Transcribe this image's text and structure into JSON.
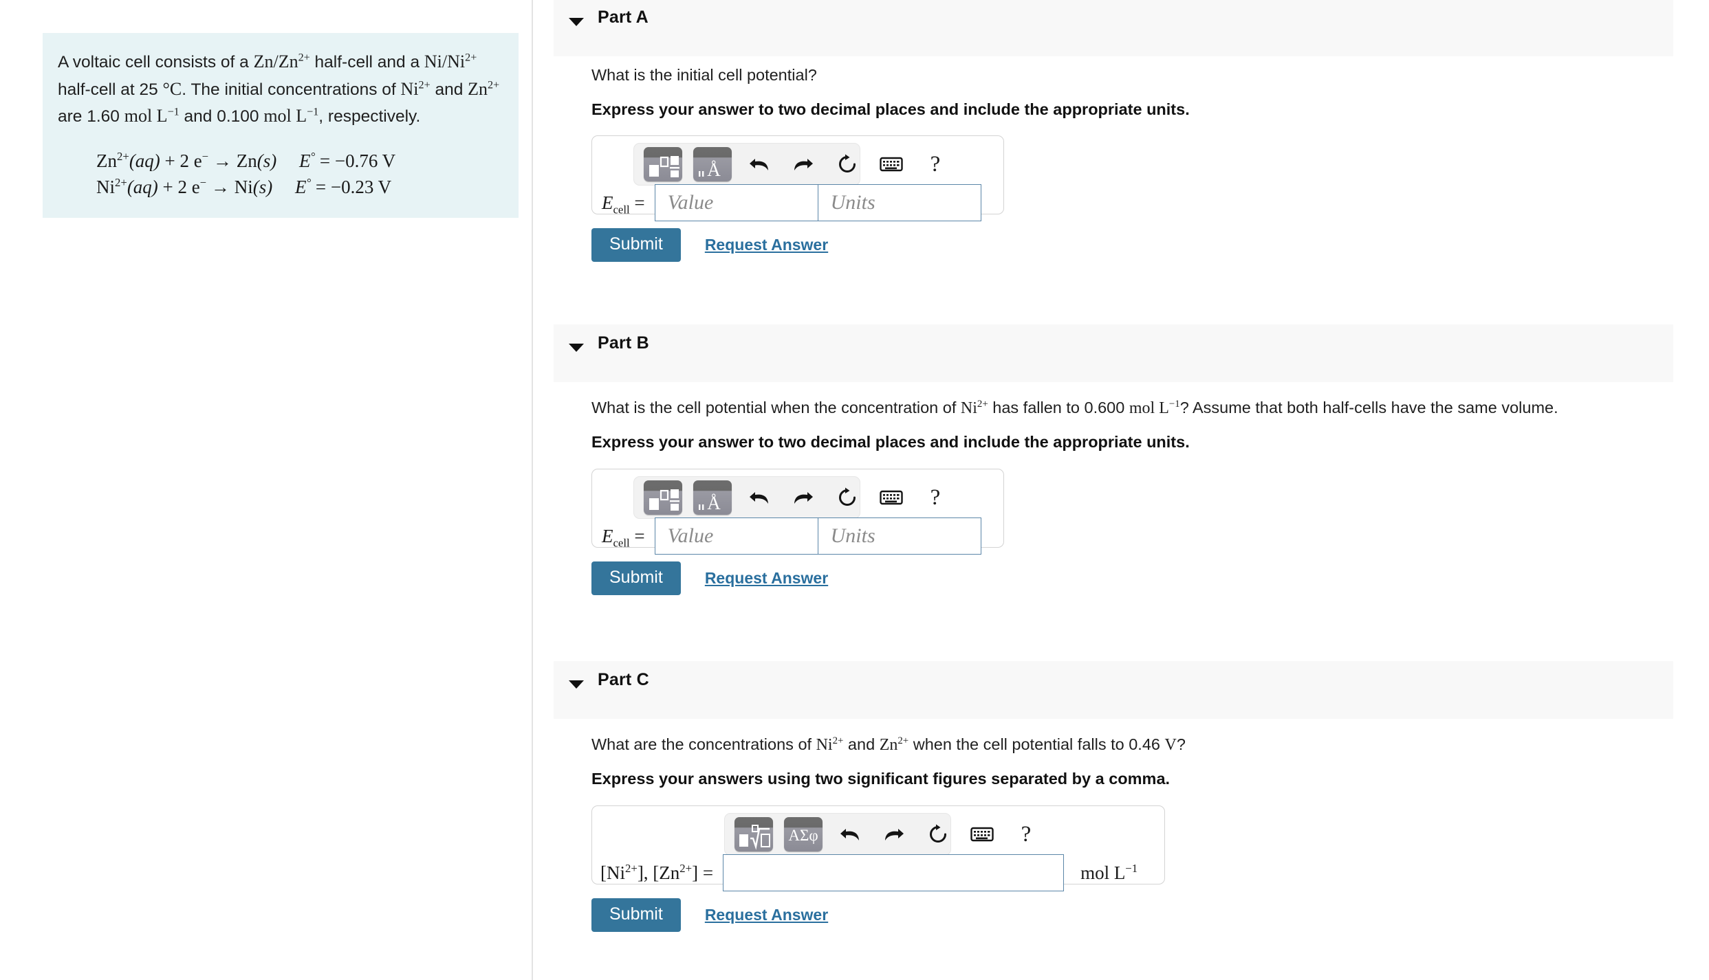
{
  "problem": {
    "intro_1": "A voltaic cell consists of a ",
    "zn_half": "Zn/Zn",
    "intro_2": " half-cell and a ",
    "ni_half": "Ni/Ni",
    "intro_3": " half-cell at 25 ",
    "degree_c": "°C",
    "intro_4": ". The initial concentrations of ",
    "ni_ion": "Ni",
    "intro_5": " and ",
    "zn_ion": "Zn",
    "intro_6": " are 1.60 ",
    "mol_unit": "mol L",
    "intro_7": " and 0.100 ",
    "intro_8": ", respectively.",
    "charge": "2+",
    "neg_one": "−1",
    "reactions": [
      {
        "species": "Zn",
        "charge": "2+",
        "state_aq": "(aq)",
        "plus_electrons": "+ 2 e",
        "electron_charge": "−",
        "arrow": "→",
        "product": "Zn",
        "state_s": "(s)",
        "e_symbol": "E",
        "e_degree": "°",
        "e_equals": "= −0.76 V"
      },
      {
        "species": "Ni",
        "charge": "2+",
        "state_aq": "(aq)",
        "plus_electrons": "+ 2 e",
        "electron_charge": "−",
        "arrow": "→",
        "product": "Ni",
        "state_s": "(s)",
        "e_symbol": "E",
        "e_degree": "°",
        "e_equals": "= −0.23 V"
      }
    ]
  },
  "parts": [
    {
      "id": "a",
      "title": "Part A",
      "question_plain": "What is the initial cell potential?",
      "instruction": "Express your answer to two decimal places and include the appropriate units.",
      "answer_label_base": "E",
      "answer_label_sub": "cell",
      "answer_label_eq": "=",
      "value_placeholder": "Value",
      "units_placeholder": "Units",
      "value_current": "",
      "units_current": "",
      "submit_label": "Submit",
      "request_label": "Request Answer",
      "toolbar": {
        "template_button": "math-template-button",
        "symbols_button": "angstrom-units-button",
        "symbols_glyph": "Å",
        "undo": "undo-icon",
        "redo": "redo-icon",
        "reset": "reset-icon",
        "keyboard": "keyboard-icon",
        "help": "?"
      }
    },
    {
      "id": "b",
      "title": "Part B",
      "q_seg_1": "What is the cell potential when the concentration of ",
      "q_ion": "Ni",
      "q_charge": "2+",
      "q_seg_2": " has fallen to 0.600 ",
      "q_unit": "mol L",
      "q_unit_exp": "−1",
      "q_seg_3": "? Assume that both half-cells have the same volume.",
      "instruction": "Express your answer to two decimal places and include the appropriate units.",
      "answer_label_base": "E",
      "answer_label_sub": "cell",
      "answer_label_eq": "=",
      "value_placeholder": "Value",
      "units_placeholder": "Units",
      "value_current": "",
      "units_current": "",
      "submit_label": "Submit",
      "request_label": "Request Answer",
      "toolbar": {
        "template_button": "math-template-button",
        "symbols_button": "angstrom-units-button",
        "symbols_glyph": "Å",
        "undo": "undo-icon",
        "redo": "redo-icon",
        "reset": "reset-icon",
        "keyboard": "keyboard-icon",
        "help": "?"
      }
    },
    {
      "id": "c",
      "title": "Part C",
      "q_seg_1": "What are the concentrations of ",
      "q_ion_1": "Ni",
      "q_charge": "2+",
      "q_seg_2": " and ",
      "q_ion_2": "Zn",
      "q_seg_3": " when the cell potential falls to 0.46 ",
      "q_volt": "V",
      "q_seg_4": "?",
      "instruction": "Express your answers using two significant figures separated by a comma.",
      "answer_label_ni": "[Ni",
      "answer_label_charge": "2+",
      "answer_label_mid": "],  [Zn",
      "answer_label_end": "] =",
      "input_value": "",
      "input_unit": "mol L",
      "input_unit_exp": "−1",
      "submit_label": "Submit",
      "request_label": "Request Answer",
      "toolbar": {
        "template_button": "math-root-template-button",
        "symbols_button": "greek-symbols-button",
        "symbols_glyph": "ΑΣφ",
        "undo": "undo-icon",
        "redo": "redo-icon",
        "reset": "reset-icon",
        "keyboard": "keyboard-icon",
        "help": "?"
      }
    }
  ],
  "colors": {
    "problem_card_bg": "#e7f3f5",
    "part_header_bg": "#f8f8f8",
    "submit_bg": "#34759b",
    "link": "#2a6f9e",
    "input_border": "#5b86a8"
  }
}
